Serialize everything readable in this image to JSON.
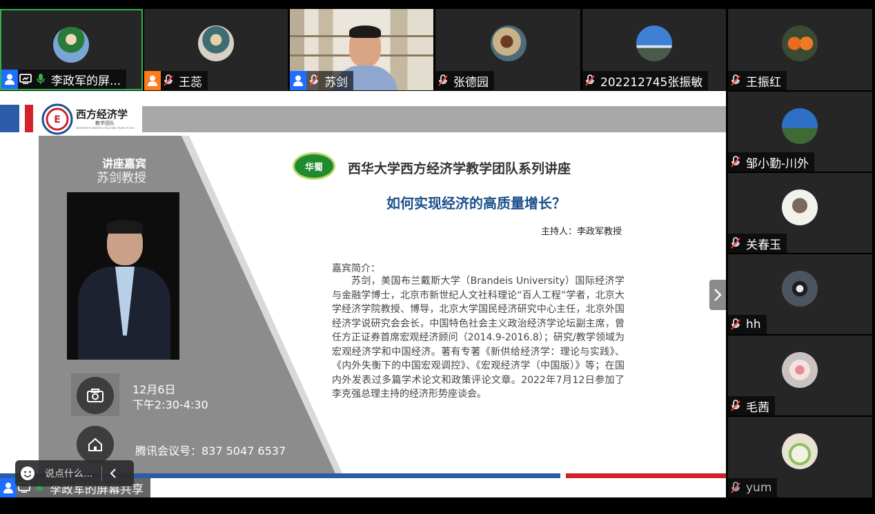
{
  "participants": [
    {
      "name": "李政军的屏...",
      "role": "sharing"
    },
    {
      "name": "王蕊"
    },
    {
      "name": "苏剑"
    },
    {
      "name": "张德园"
    },
    {
      "name": "202212745张振敏"
    },
    {
      "name": "王振红"
    },
    {
      "name": "邹小勤-川外"
    },
    {
      "name": "关春玉"
    },
    {
      "name": "hh"
    },
    {
      "name": "毛茜"
    },
    {
      "name": "yum"
    }
  ],
  "slide": {
    "logo_title": "西方经济学",
    "logo_sub": "教学团队",
    "logo_tiny": "WESTERN ECONOMICS TEACHING TEAM OF XHU",
    "guest_label": "讲座嘉宾",
    "guest_name": "苏剑教授",
    "date": "12月6日",
    "time": "下午2:30-4:30",
    "meeting": "腾讯会议号：837 5047 6537",
    "seal": "华蜀",
    "series_title": "西华大学西方经济学教学团队系列讲座",
    "main_title": "如何实现经济的高质量增长？",
    "host": "主持人：李政军教授",
    "intro_label": "嘉宾简介：",
    "intro_text": "苏剑，美国布兰戴斯大学（Brandeis University）国际经济学与金融学博士，北京市新世纪人文社科理论“百人工程”学者，北京大学经济学院教授、博导，北京大学国民经济研究中心主任，北京外国经济学说研究会会长，中国特色社会主义政治经济学论坛副主席，曾任方正证券首席宏观经济顾问（2014.9-2016.8）；研究/教学领域为宏观经济学和中国经济。著有专著《新供给经济学：理论与实践》、《内外失衡下的中国宏观调控》、《宏观经济学（中国版）》等；在国内外发表过多篇学术论文和政策评论文章。2022年7月12日参加了李克强总理主持的经济形势座谈会。"
  },
  "share_label": "李政军的屏幕共享",
  "chat_placeholder": "说点什么...",
  "colors": {
    "accent_green": "#2fb24c",
    "user_blue": "#1e6fff",
    "user_orange": "#ff7a1a",
    "title_blue": "#1c4f8a"
  }
}
